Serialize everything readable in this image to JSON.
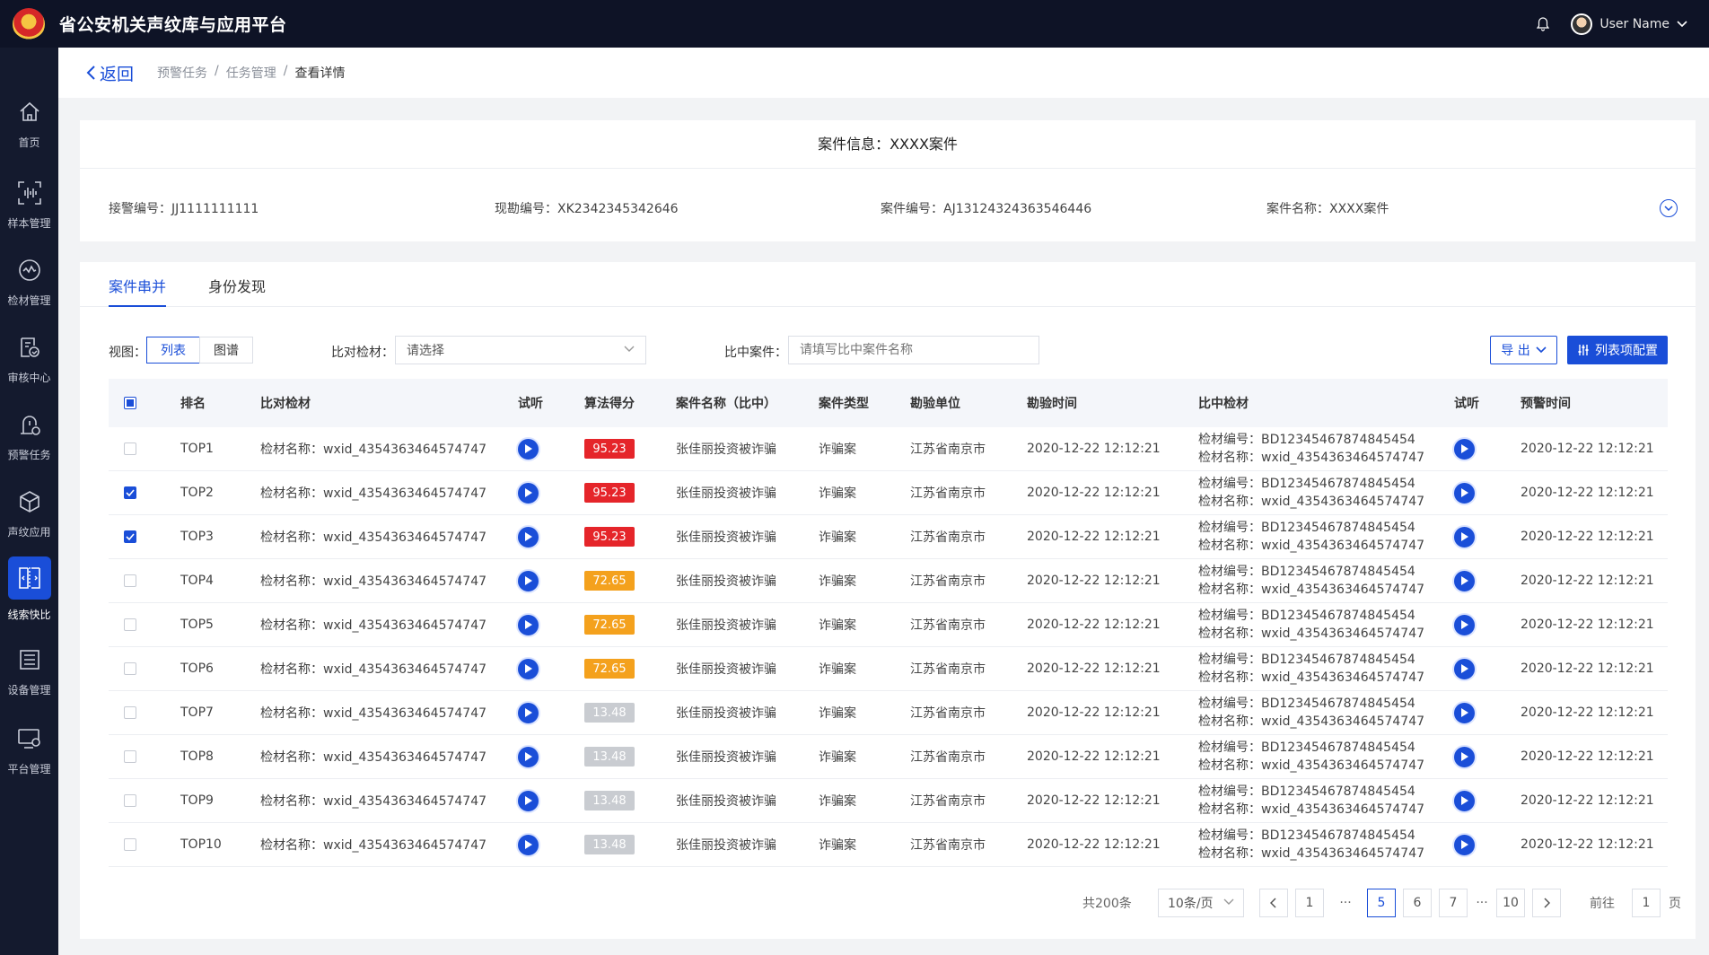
{
  "header": {
    "app_title": "省公安机关声纹库与应用平台",
    "user_name": "User Name"
  },
  "sidebar": {
    "items": [
      {
        "label": "首页",
        "icon": "home-icon"
      },
      {
        "label": "样本管理",
        "icon": "voiceprint-icon"
      },
      {
        "label": "检材管理",
        "icon": "wave-circle-icon"
      },
      {
        "label": "审核中心",
        "icon": "audit-doc-icon"
      },
      {
        "label": "预警任务",
        "icon": "alert-task-icon"
      },
      {
        "label": "声纹应用",
        "icon": "cube-icon"
      },
      {
        "label": "线索快比",
        "icon": "compare-icon",
        "active": true
      },
      {
        "label": "设备管理",
        "icon": "list-device-icon"
      },
      {
        "label": "平台管理",
        "icon": "monitor-gear-icon"
      }
    ]
  },
  "breadcrumb": {
    "back_label": "返回",
    "items": [
      "预警任务",
      "任务管理",
      "查看详情"
    ]
  },
  "case_info": {
    "title": "案件信息：XXXX案件",
    "fields": [
      "接警编号：JJ1111111111",
      "现勘编号：XK2342345342646",
      "案件编号：AJ13124324363546446",
      "案件名称：XXXX案件"
    ]
  },
  "tabs": [
    "案件串并",
    "身份发现"
  ],
  "filters": {
    "view_label": "视图：",
    "view_options": [
      "列表",
      "图谱"
    ],
    "material_label": "比对检材：",
    "material_placeholder": "请选择",
    "case_label": "比中案件：",
    "case_placeholder": "请填写比中案件名称",
    "export_label": "导 出",
    "config_label": "列表项配置"
  },
  "table": {
    "headers": [
      "排名",
      "比对检材",
      "试听",
      "算法得分",
      "案件名称（比中）",
      "案件类型",
      "勘验单位",
      "勘验时间",
      "比中检材",
      "试听",
      "预警时间"
    ],
    "rows": [
      {
        "rank": "TOP1",
        "material": "检材名称：wxid_4354363464574747",
        "score": "95.23",
        "level": "red",
        "case": "张佳丽投资被诈骗",
        "type": "诈骗案",
        "unit": "江苏省南京市",
        "time": "2020-12-22  12:12:21",
        "hit_no": "检材编号：BD12345467874845454",
        "hit_name": "检材名称：wxid_4354363464574747",
        "alert_time": "2020-12-22  12:12:21",
        "checked": false
      },
      {
        "rank": "TOP2",
        "material": "检材名称：wxid_4354363464574747",
        "score": "95.23",
        "level": "red",
        "case": "张佳丽投资被诈骗",
        "type": "诈骗案",
        "unit": "江苏省南京市",
        "time": "2020-12-22  12:12:21",
        "hit_no": "检材编号：BD12345467874845454",
        "hit_name": "检材名称：wxid_4354363464574747",
        "alert_time": "2020-12-22  12:12:21",
        "checked": true
      },
      {
        "rank": "TOP3",
        "material": "检材名称：wxid_4354363464574747",
        "score": "95.23",
        "level": "red",
        "case": "张佳丽投资被诈骗",
        "type": "诈骗案",
        "unit": "江苏省南京市",
        "time": "2020-12-22  12:12:21",
        "hit_no": "检材编号：BD12345467874845454",
        "hit_name": "检材名称：wxid_4354363464574747",
        "alert_time": "2020-12-22  12:12:21",
        "checked": true
      },
      {
        "rank": "TOP4",
        "material": "检材名称：wxid_4354363464574747",
        "score": "72.65",
        "level": "orange",
        "case": "张佳丽投资被诈骗",
        "type": "诈骗案",
        "unit": "江苏省南京市",
        "time": "2020-12-22  12:12:21",
        "hit_no": "检材编号：BD12345467874845454",
        "hit_name": "检材名称：wxid_4354363464574747",
        "alert_time": "2020-12-22  12:12:21",
        "checked": false
      },
      {
        "rank": "TOP5",
        "material": "检材名称：wxid_4354363464574747",
        "score": "72.65",
        "level": "orange",
        "case": "张佳丽投资被诈骗",
        "type": "诈骗案",
        "unit": "江苏省南京市",
        "time": "2020-12-22  12:12:21",
        "hit_no": "检材编号：BD12345467874845454",
        "hit_name": "检材名称：wxid_4354363464574747",
        "alert_time": "2020-12-22  12:12:21",
        "checked": false
      },
      {
        "rank": "TOP6",
        "material": "检材名称：wxid_4354363464574747",
        "score": "72.65",
        "level": "orange",
        "case": "张佳丽投资被诈骗",
        "type": "诈骗案",
        "unit": "江苏省南京市",
        "time": "2020-12-22  12:12:21",
        "hit_no": "检材编号：BD12345467874845454",
        "hit_name": "检材名称：wxid_4354363464574747",
        "alert_time": "2020-12-22  12:12:21",
        "checked": false
      },
      {
        "rank": "TOP7",
        "material": "检材名称：wxid_4354363464574747",
        "score": "13.48",
        "level": "grey",
        "case": "张佳丽投资被诈骗",
        "type": "诈骗案",
        "unit": "江苏省南京市",
        "time": "2020-12-22  12:12:21",
        "hit_no": "检材编号：BD12345467874845454",
        "hit_name": "检材名称：wxid_4354363464574747",
        "alert_time": "2020-12-22  12:12:21",
        "checked": false
      },
      {
        "rank": "TOP8",
        "material": "检材名称：wxid_4354363464574747",
        "score": "13.48",
        "level": "grey",
        "case": "张佳丽投资被诈骗",
        "type": "诈骗案",
        "unit": "江苏省南京市",
        "time": "2020-12-22  12:12:21",
        "hit_no": "检材编号：BD12345467874845454",
        "hit_name": "检材名称：wxid_4354363464574747",
        "alert_time": "2020-12-22  12:12:21",
        "checked": false
      },
      {
        "rank": "TOP9",
        "material": "检材名称：wxid_4354363464574747",
        "score": "13.48",
        "level": "grey",
        "case": "张佳丽投资被诈骗",
        "type": "诈骗案",
        "unit": "江苏省南京市",
        "time": "2020-12-22  12:12:21",
        "hit_no": "检材编号：BD12345467874845454",
        "hit_name": "检材名称：wxid_4354363464574747",
        "alert_time": "2020-12-22  12:12:21",
        "checked": false
      },
      {
        "rank": "TOP10",
        "material": "检材名称：wxid_4354363464574747",
        "score": "13.48",
        "level": "grey",
        "case": "张佳丽投资被诈骗",
        "type": "诈骗案",
        "unit": "江苏省南京市",
        "time": "2020-12-22  12:12:21",
        "hit_no": "检材编号：BD12345467874845454",
        "hit_name": "检材名称：wxid_4354363464574747",
        "alert_time": "2020-12-22  12:12:21",
        "checked": false
      }
    ]
  },
  "pagination": {
    "total_label": "共200条",
    "page_size_label": "10条/页",
    "pages": [
      "1",
      "5",
      "6",
      "7",
      "10"
    ],
    "current": "5",
    "ellipsis": "···",
    "goto_label": "前往",
    "goto_value": "1",
    "goto_suffix": "页"
  },
  "colors": {
    "primary": "#1a4ed8",
    "score_high": "#e5252a",
    "score_mid": "#f4a11d",
    "score_low": "#c9ccd1",
    "header_bg": "#0e1326",
    "sidebar_bg": "#141a2e"
  }
}
